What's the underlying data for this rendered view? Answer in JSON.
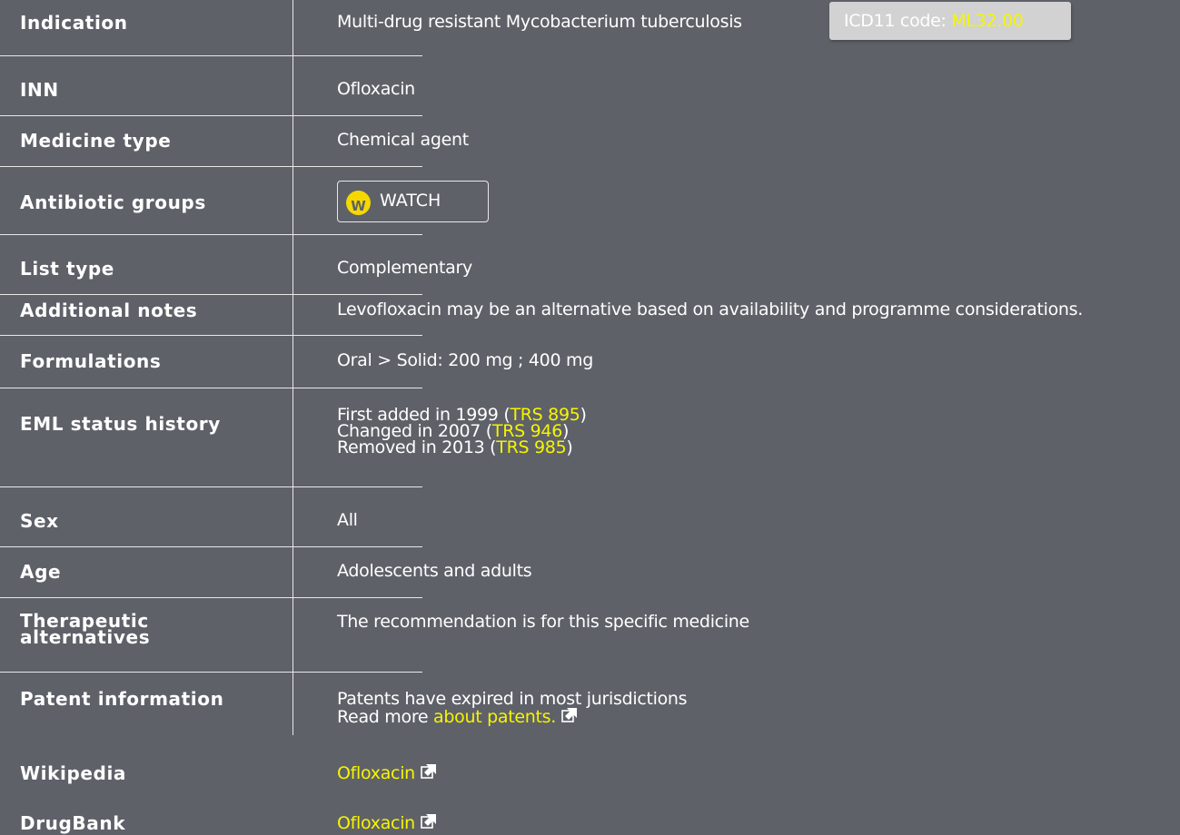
{
  "rows": {
    "indication": {
      "label": "Indication",
      "value": "Multi-drug resistant Mycobacterium tuberculosis",
      "icd_prefix": "ICD11 code: ",
      "icd_code": "ML32.00"
    },
    "inn": {
      "label": "INN",
      "value": "Ofloxacin"
    },
    "medicine_type": {
      "label": "Medicine type",
      "value": "Chemical agent"
    },
    "antibiotic_groups": {
      "label": "Antibiotic groups",
      "badge_letter": "W",
      "badge_label": "WATCH"
    },
    "list_type": {
      "label": "List type",
      "value": "Complementary"
    },
    "additional_notes": {
      "label": "Additional notes",
      "value": "Levofloxacin may be an alternative based on availability and programme considerations."
    },
    "formulations": {
      "label": "Formulations",
      "value": "Oral > Solid: 200 mg ; 400 mg"
    },
    "eml_status_history": {
      "label": "EML status history",
      "entries": [
        {
          "text": "First added in 1999 (",
          "link": "TRS 895",
          "close": ")"
        },
        {
          "text": "Changed in 2007 (",
          "link": "TRS 946",
          "close": ")"
        },
        {
          "text": "Removed in 2013 (",
          "link": "TRS 985",
          "close": ")"
        }
      ]
    },
    "sex": {
      "label": "Sex",
      "value": "All"
    },
    "age": {
      "label": "Age",
      "value": "Adolescents and adults"
    },
    "therapeutic_alternatives": {
      "label_line1": "Therapeutic",
      "label_line2": "alternatives",
      "value": "The recommendation is for this specific medicine"
    },
    "patent_information": {
      "label": "Patent information",
      "line1": "Patents have expired in most jurisdictions",
      "line2_prefix": "Read more ",
      "line2_link": "about patents."
    },
    "wikipedia": {
      "label": "Wikipedia",
      "link": "Ofloxacin"
    },
    "drugbank": {
      "label": "DrugBank",
      "link": "Ofloxacin"
    }
  },
  "colors": {
    "background": "#5f6169",
    "link": "#f5f500",
    "watch_badge": "#f5d800",
    "icd_badge": "#d2d2d2"
  },
  "icons": {
    "external_link": "external-link-icon",
    "watch": "watch-group-icon"
  }
}
